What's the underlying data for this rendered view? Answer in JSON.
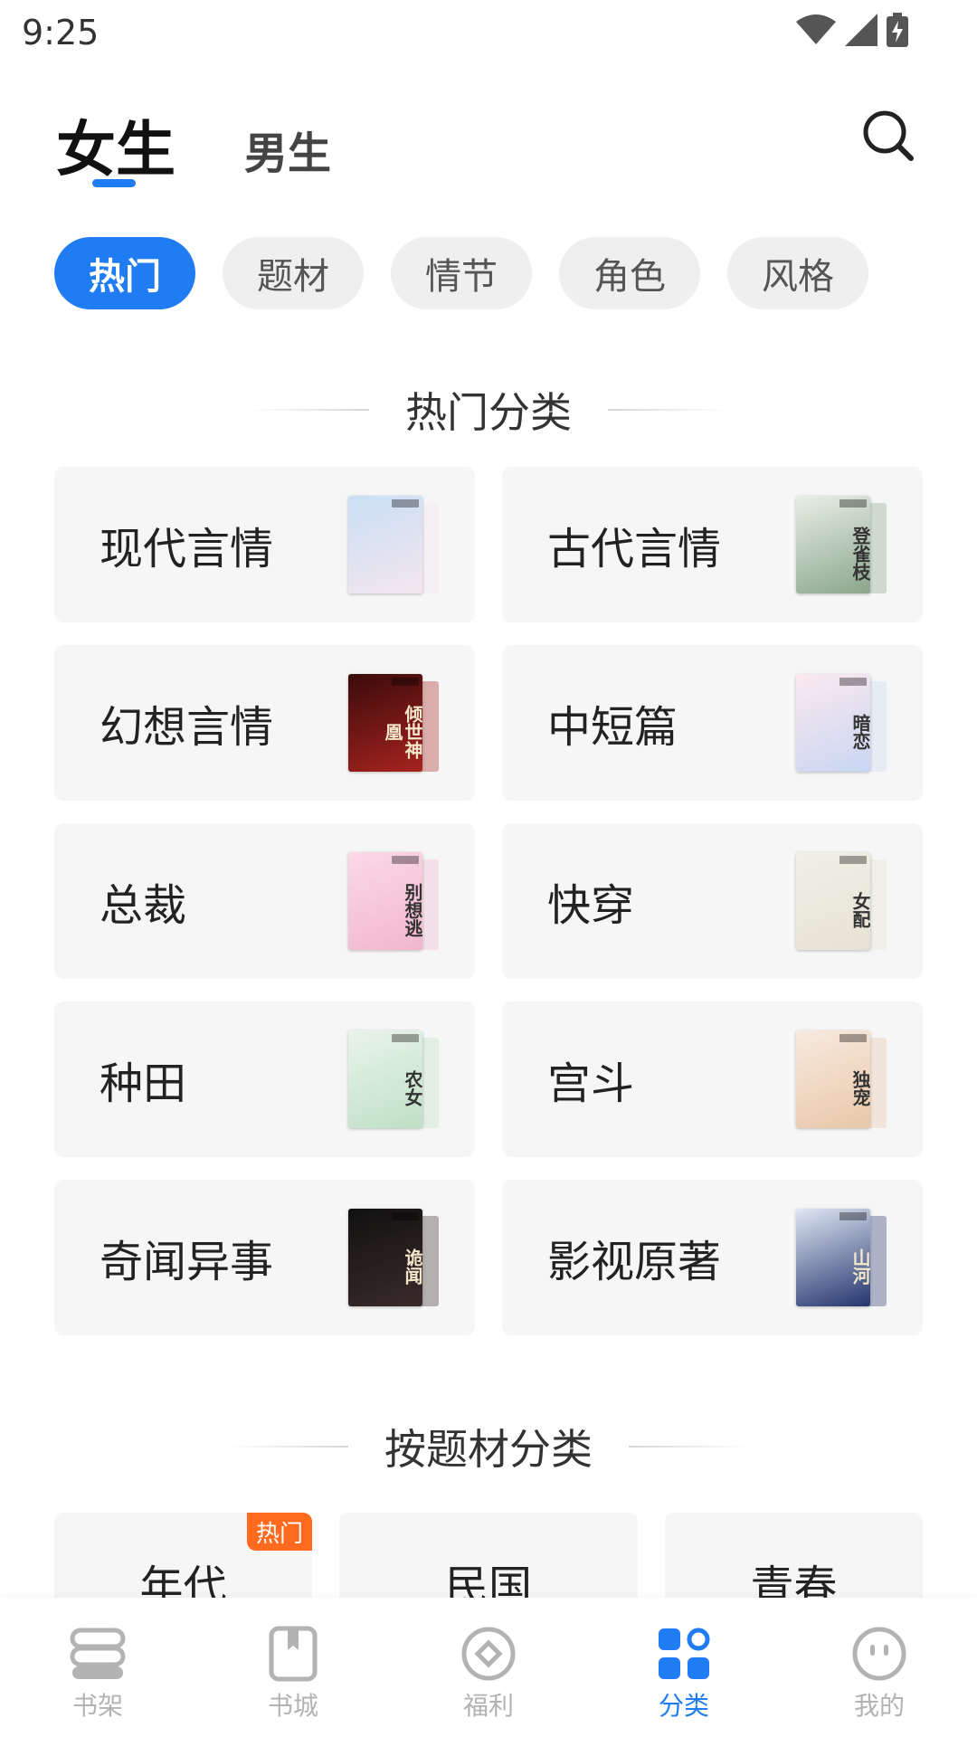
{
  "status_bar": {
    "time": "9:25"
  },
  "header": {
    "tabs": [
      {
        "label": "女生",
        "active": true
      },
      {
        "label": "男生",
        "active": false
      }
    ]
  },
  "chips": [
    "热门",
    "题材",
    "情节",
    "角色",
    "风格"
  ],
  "hot_section": {
    "title": "热门分类",
    "categories": [
      {
        "label": "现代言情",
        "cover_colors": [
          "#c9dff5",
          "#f3e6ee"
        ],
        "cover_text": ""
      },
      {
        "label": "古代言情",
        "cover_colors": [
          "#e9efe6",
          "#8aa68c"
        ],
        "cover_text": "登雀枝"
      },
      {
        "label": "幻想言情",
        "cover_colors": [
          "#3a0b0b",
          "#a7231f"
        ],
        "cover_text": "倾世神凰"
      },
      {
        "label": "中短篇",
        "cover_colors": [
          "#fbe9ef",
          "#c9d6f2"
        ],
        "cover_text": "暗恋"
      },
      {
        "label": "总裁",
        "cover_colors": [
          "#fbd9e6",
          "#f2b6cf"
        ],
        "cover_text": "别想逃"
      },
      {
        "label": "快穿",
        "cover_colors": [
          "#f1efe6",
          "#e6e2d4"
        ],
        "cover_text": "女配"
      },
      {
        "label": "种田",
        "cover_colors": [
          "#e9f4ea",
          "#bfe0c6"
        ],
        "cover_text": "农女"
      },
      {
        "label": "宫斗",
        "cover_colors": [
          "#f7eadf",
          "#e9c7a8"
        ],
        "cover_text": "独宠"
      },
      {
        "label": "奇闻异事",
        "cover_colors": [
          "#111111",
          "#3a2a2a"
        ],
        "cover_text": "诡闻"
      },
      {
        "label": "影视原著",
        "cover_colors": [
          "#dfe7f3",
          "#25356e"
        ],
        "cover_text": "山河"
      }
    ]
  },
  "theme_section": {
    "title": "按题材分类",
    "cards": [
      {
        "label": "年代",
        "badge": "热门"
      },
      {
        "label": "民国",
        "badge": ""
      },
      {
        "label": "青春",
        "badge": ""
      }
    ]
  },
  "bottom_nav": [
    {
      "label": "书架",
      "icon": "bookshelf-icon",
      "active": false
    },
    {
      "label": "书城",
      "icon": "bookstore-icon",
      "active": false
    },
    {
      "label": "福利",
      "icon": "welfare-icon",
      "active": false
    },
    {
      "label": "分类",
      "icon": "category-icon",
      "active": true
    },
    {
      "label": "我的",
      "icon": "profile-icon",
      "active": false
    }
  ],
  "colors": {
    "accent": "#1f7cf2",
    "hot_badge": "#ff6a1f",
    "card_bg": "#f6f6f6"
  }
}
